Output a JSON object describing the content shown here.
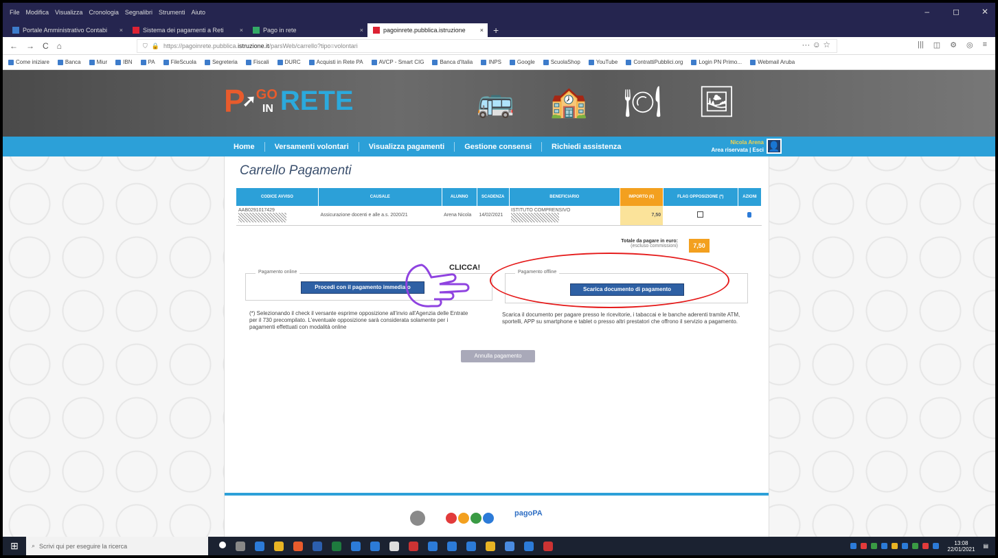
{
  "window": {
    "menu": [
      "File",
      "Modifica",
      "Visualizza",
      "Cronologia",
      "Segnalibri",
      "Strumenti",
      "Aiuto"
    ],
    "controls": {
      "minimize": "–",
      "maximize": "◻",
      "close": "✕"
    }
  },
  "tabs": [
    {
      "label": "Portale Amministrativo Contabi",
      "close": "×"
    },
    {
      "label": "Sistema dei pagamenti a Reti",
      "close": "×"
    },
    {
      "label": "Pago in rete",
      "close": "×"
    },
    {
      "label": "pagoinrete.pubblica.istruzione",
      "close": "×",
      "active": true
    }
  ],
  "new_tab": "+",
  "nav": {
    "back": "←",
    "forward": "→",
    "reload": "C",
    "home": "⌂",
    "url_prefix": "https://pagoinrete.pubblica.",
    "url_domain": "istruzione.it",
    "url_path": "/parsWeb/carrello?tipo=volontari",
    "url_actions": "··· ☺ ☆",
    "toolbar_icons": [
      "|||",
      "◫",
      "⚙",
      "◎",
      "≡"
    ]
  },
  "bookmarks": [
    "Come iniziare",
    "Banca",
    "Miur",
    "IBN",
    "PA",
    "FileScuola",
    "Segreteria",
    "Fiscali",
    "DURC",
    "Acquisti in Rete PA",
    "AVCP - Smart CIG",
    "Banca d'Italia",
    "INPS",
    "Google",
    "ScuolaShop",
    "YouTube",
    "ContrattiPubblici.org",
    "Login PN Primo...",
    "Webmail Aruba"
  ],
  "site": {
    "logo": {
      "p": "P",
      "go": "GO",
      "in": "IN",
      "rete": "RETE"
    },
    "menu": [
      "Home",
      "Versamenti volontari",
      "Visualizza pagamenti",
      "Gestione consensi",
      "Richiedi assistenza"
    ],
    "user": {
      "name": "Nicola Arena",
      "area": "Area riservata | Esci"
    },
    "page_title": "Carrello Pagamenti",
    "table": {
      "headers": [
        "CODICE AVVISO",
        "CAUSALE",
        "ALUNNO",
        "SCADENZA",
        "BENEFICIARIO",
        "IMPORTO (€)",
        "FLAG OPPOSIZIONE (*)",
        "AZIONI"
      ],
      "row": {
        "codice": "AAB0291017429",
        "causale": "Assicurazione docenti e alle a.s. 2020/21",
        "alunno": "Arena Nicola",
        "scadenza": "14/02/2021",
        "beneficiario": "ISTITUTO COMPRENSIVO",
        "importo": "7,50"
      }
    },
    "total_label": "Totale da pagare in euro:",
    "total_note": "(escluso commissioni)",
    "total_value": "7,50",
    "online": {
      "legend": "Pagamento online",
      "button": "Procedi con il pagamento immediato",
      "description": "(*) Selezionando il check il versante esprime opposizione all'invio all'Agenzia delle Entrate per il 730 precompilato. L'eventuale opposizione sarà considerata solamente per i pagamenti effettuati con modalità online"
    },
    "offline": {
      "legend": "Pagamento offline",
      "button": "Scarica documento di pagamento",
      "description": "Scarica il documento per pagare presso le ricevitorie, i tabaccai e le banche aderenti tramite ATM, sportelli, APP su smartphone e tablet o presso altri prestatori che offrono il servizio a pagamento."
    },
    "annulla": "Annulla pagamento",
    "annotation": "CLICCA!",
    "footer": {
      "pagopa": "pagoPA"
    }
  },
  "taskbar": {
    "search_placeholder": "Scrivi qui per eseguire la ricerca",
    "time": "13:08",
    "date": "22/01/2021"
  }
}
